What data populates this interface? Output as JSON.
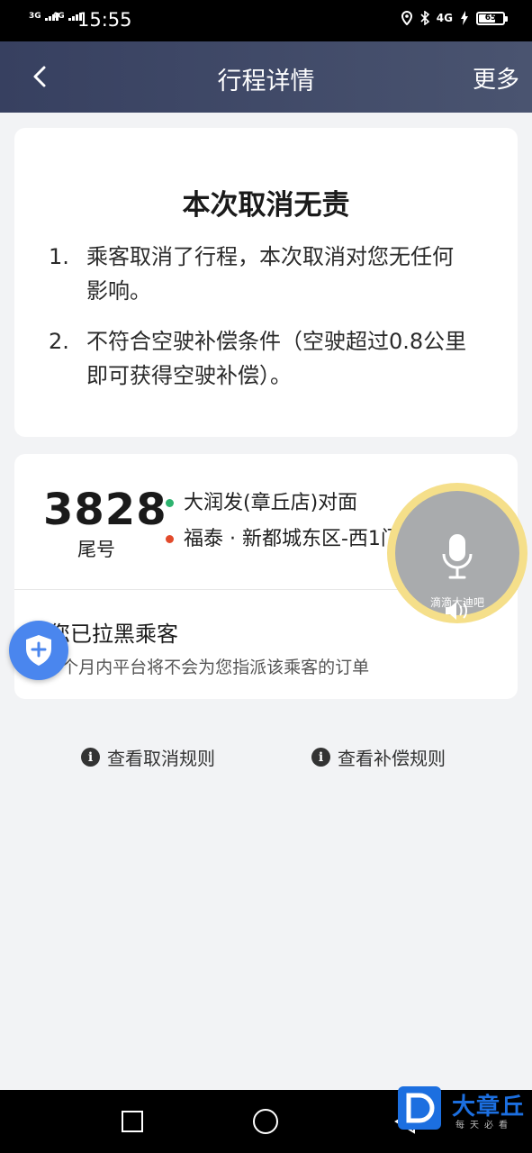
{
  "status_bar": {
    "net1": "3G",
    "net2": "4G",
    "time": "15:55",
    "net3": "4G",
    "battery": "65"
  },
  "nav": {
    "title": "行程详情",
    "more": "更多"
  },
  "result": {
    "title": "本次取消无责",
    "items": [
      {
        "num": "1.",
        "text": "乘客取消了行程，本次取消对您无任何影响。"
      },
      {
        "num": "2.",
        "text": "不符合空驶补偿条件（空驶超过0.8公里即可获得空驶补偿）。"
      }
    ]
  },
  "trip": {
    "tail_number": "3828",
    "tail_label": "尾号",
    "origin": "大润发(章丘店)对面",
    "destination": "福泰 · 新都城东区-西1门",
    "origin_color": "#2db36f",
    "destination_color": "#e24a2b",
    "blacklist_title": "您已拉黑乘客",
    "blacklist_desc": "6个月内平台将不会为您指派该乘客的订单"
  },
  "links": {
    "cancel_rules": "查看取消规则",
    "compensation_rules": "查看补偿规则"
  },
  "voice": {
    "label": "滴滴大迪吧"
  },
  "watermark": {
    "brand": "大章丘",
    "tagline": "每天必看"
  },
  "colors": {
    "nav_bg": "#3f4865",
    "fab_blue": "#4a86ee",
    "voice_ring": "#f5df8a"
  },
  "icons": [
    "back-arrow-icon",
    "info-icon",
    "shield-plus-icon",
    "microphone-icon",
    "speaker-icon"
  ]
}
